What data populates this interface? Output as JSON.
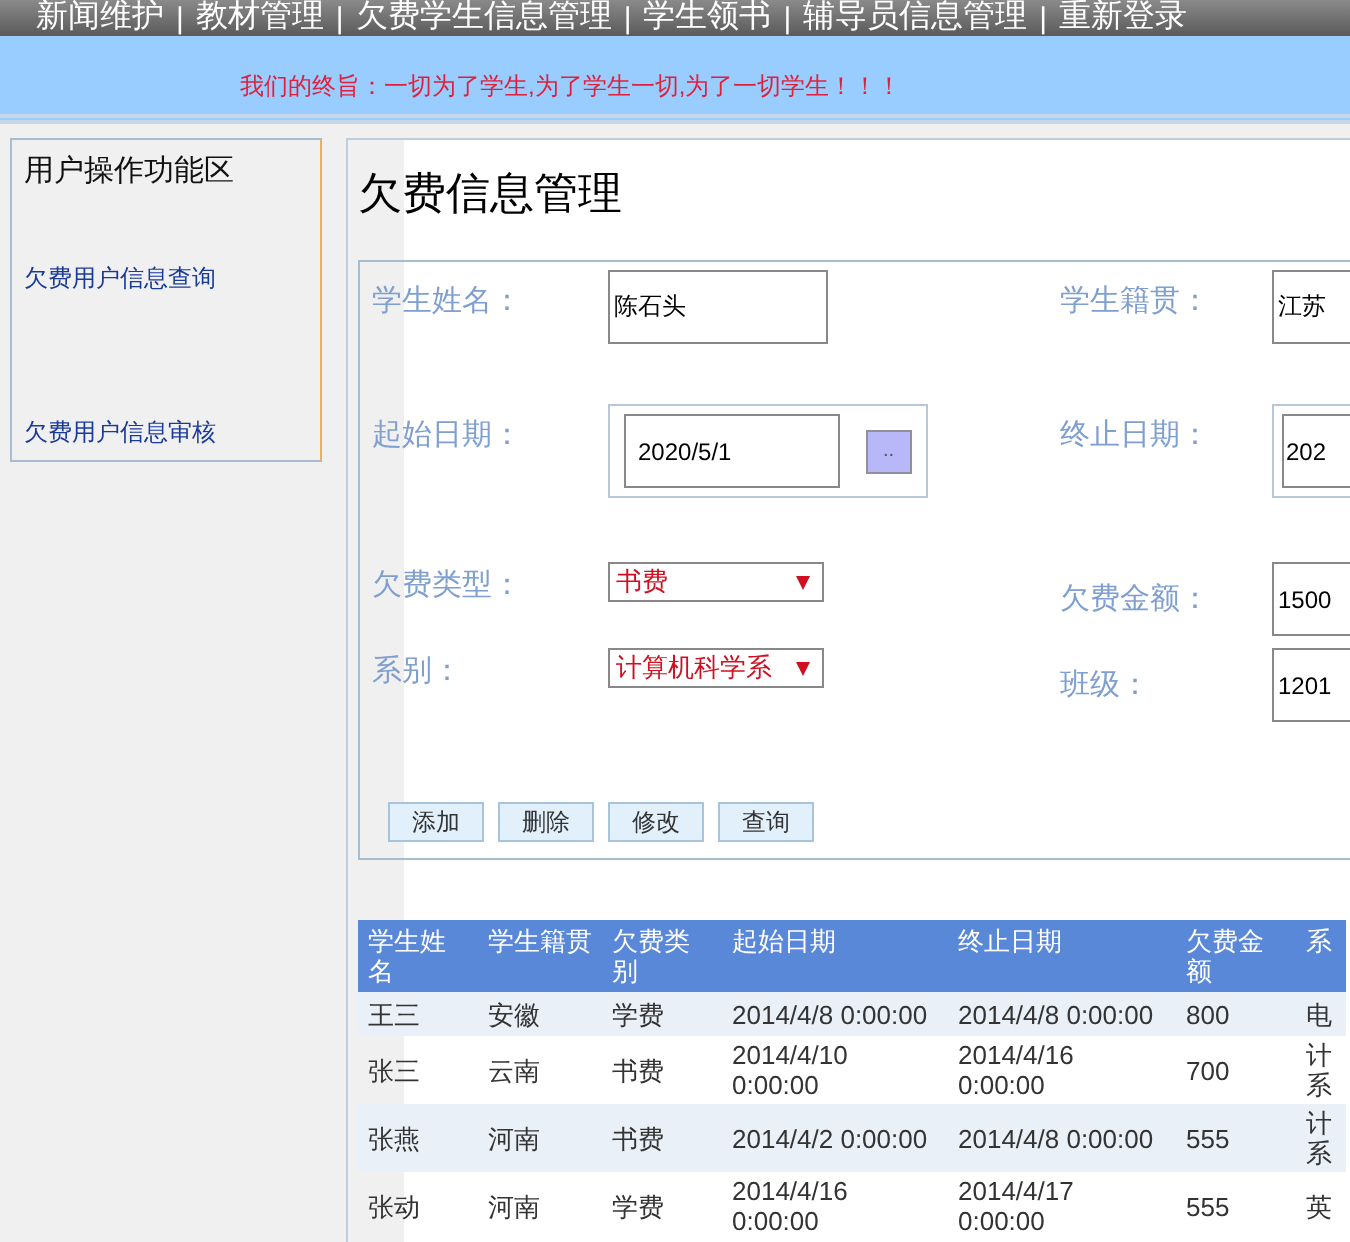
{
  "nav": {
    "items": [
      {
        "kind": "link",
        "text": "新闻维护"
      },
      {
        "kind": "separator",
        "text": "|"
      },
      {
        "kind": "link",
        "text": "教材管理"
      },
      {
        "kind": "separator",
        "text": "|"
      },
      {
        "kind": "link",
        "text": "欠费学生信息管理"
      },
      {
        "kind": "separator",
        "text": "|"
      },
      {
        "kind": "link",
        "text": "学生领书"
      },
      {
        "kind": "separator",
        "text": "|"
      },
      {
        "kind": "link",
        "text": "辅导员信息管理"
      },
      {
        "kind": "separator",
        "text": "|"
      },
      {
        "kind": "link",
        "text": "重新登录"
      }
    ]
  },
  "motto": "我们的终旨：一切为了学生,为了学生一切,为了一切学生！！！",
  "sidebar": {
    "title": "用户操作功能区",
    "items": [
      {
        "label": "欠费用户信息查询"
      },
      {
        "label": "欠费用户信息审核"
      }
    ]
  },
  "page_title": "欠费信息管理",
  "form": {
    "rows": [
      [
        {
          "label": "学生姓名：",
          "kind": "text",
          "value": "陈石头"
        },
        {
          "label": "学生籍贯：",
          "kind": "text",
          "value": "江苏"
        }
      ],
      [
        {
          "label": "起始日期：",
          "kind": "date",
          "value": "2020/5/1",
          "button": ".."
        },
        {
          "label": "终止日期：",
          "kind": "date",
          "value": "202"
        }
      ],
      [
        {
          "label": "欠费类型：",
          "kind": "select",
          "value": "书费"
        },
        {
          "label": "欠费金额：",
          "kind": "text",
          "value": "1500"
        }
      ],
      [
        {
          "label": "系别：",
          "kind": "select",
          "value": "计算机科学系"
        },
        {
          "label": "班级：",
          "kind": "text",
          "value": "1201"
        }
      ]
    ],
    "buttons": [
      "添加",
      "删除",
      "修改",
      "查询"
    ]
  },
  "table": {
    "columns": [
      "学生姓名",
      "学生籍贯",
      "欠费类别",
      "起始日期",
      "终止日期",
      "欠费金额",
      "系"
    ],
    "rows": [
      [
        "王三",
        "安徽",
        "学费",
        "2014/4/8 0:00:00",
        "2014/4/8 0:00:00",
        "800",
        "电"
      ],
      [
        "张三",
        "云南",
        "书费",
        "2014/4/10 0:00:00",
        "2014/4/16 0:00:00",
        "700",
        "计系"
      ],
      [
        "张燕",
        "河南",
        "书费",
        "2014/4/2 0:00:00",
        "2014/4/8 0:00:00",
        "555",
        "计系"
      ],
      [
        "张动",
        "河南",
        "学费",
        "2014/4/16 0:00:00",
        "2014/4/17 0:00:00",
        "555",
        "英"
      ]
    ]
  }
}
